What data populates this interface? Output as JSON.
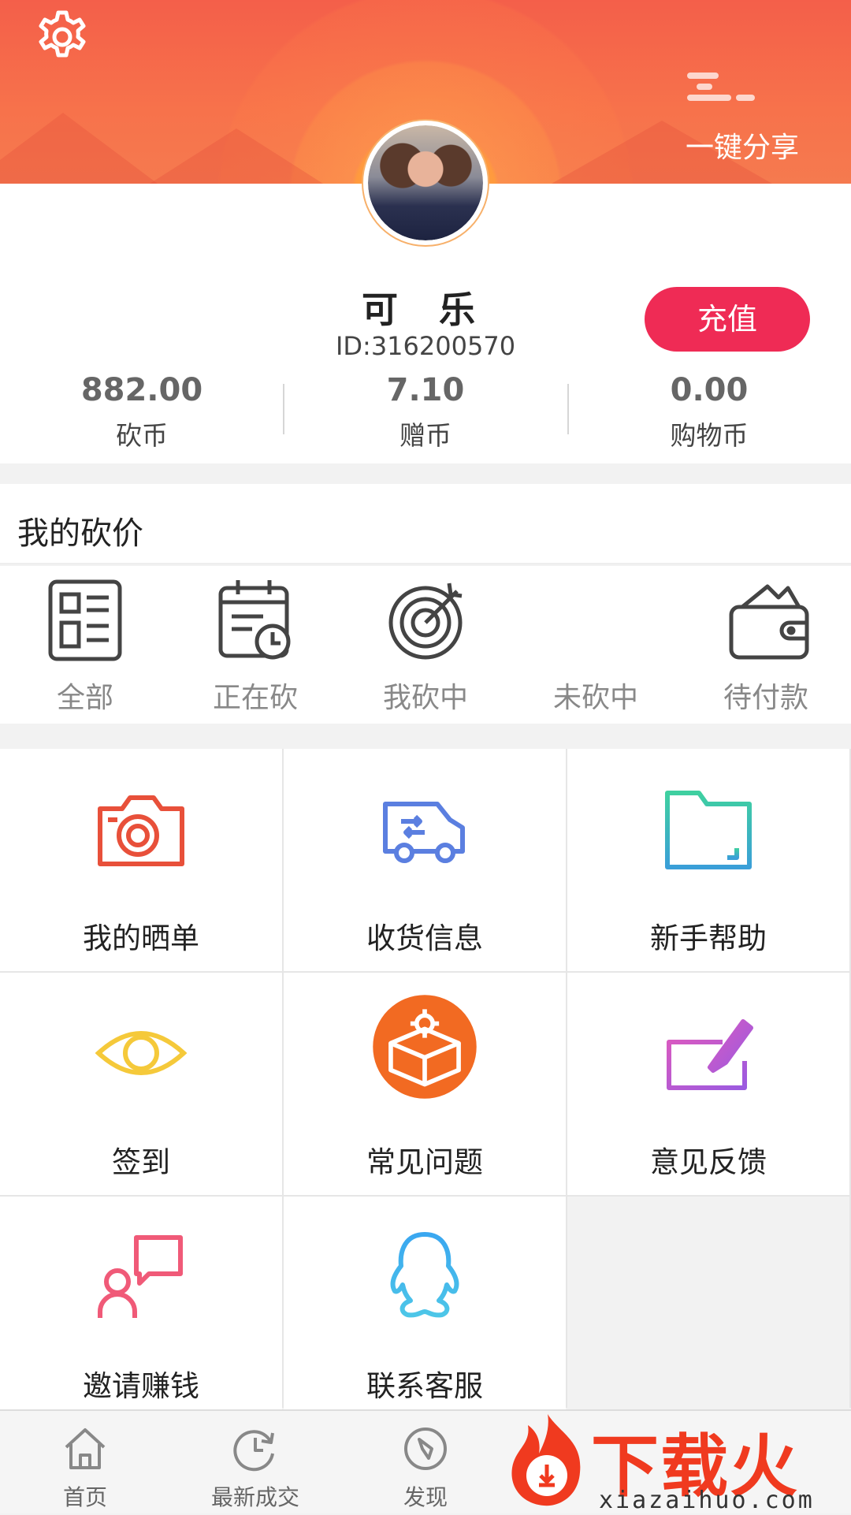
{
  "header": {
    "share_label": "一键分享",
    "icons": {
      "settings": "gear-icon"
    }
  },
  "profile": {
    "name": "可 乐",
    "id_text": "ID:316200570",
    "recharge_label": "充值",
    "stats": [
      {
        "value": "882.00",
        "label": "砍币"
      },
      {
        "value": "7.10",
        "label": "赠币"
      },
      {
        "value": "0.00",
        "label": "购物币"
      }
    ]
  },
  "bargain": {
    "title": "我的砍价",
    "items": [
      {
        "label": "全部",
        "icon": "list-icon"
      },
      {
        "label": "正在砍",
        "icon": "calendar-clock-icon"
      },
      {
        "label": "我砍中",
        "icon": "target-icon"
      },
      {
        "label": "未砍中",
        "icon": ""
      },
      {
        "label": "待付款",
        "icon": "wallet-icon"
      }
    ]
  },
  "grid": [
    {
      "label": "我的晒单",
      "icon": "camera-icon",
      "color": "#e8503a"
    },
    {
      "label": "收货信息",
      "icon": "delivery-van-icon",
      "color": "#5b7fe0"
    },
    {
      "label": "新手帮助",
      "icon": "folder-icon",
      "color": "#3fc7a6"
    },
    {
      "label": "签到",
      "icon": "eye-icon",
      "color": "#f5c93a"
    },
    {
      "label": "常见问题",
      "icon": "box-gear-icon",
      "color": "#f26a22"
    },
    {
      "label": "意见反馈",
      "icon": "feedback-pen-icon",
      "color": "#b15bd6"
    },
    {
      "label": "邀请赚钱",
      "icon": "invite-chat-icon",
      "color": "#f05a78"
    },
    {
      "label": "联系客服",
      "icon": "qq-penguin-icon",
      "color": "#3aa7f0"
    }
  ],
  "nav": [
    {
      "label": "首页",
      "icon": "home-icon"
    },
    {
      "label": "最新成交",
      "icon": "clock-refresh-icon"
    },
    {
      "label": "发现",
      "icon": "compass-icon"
    }
  ],
  "watermark": {
    "title": "下载火",
    "url": "xiazaihuo.com"
  }
}
